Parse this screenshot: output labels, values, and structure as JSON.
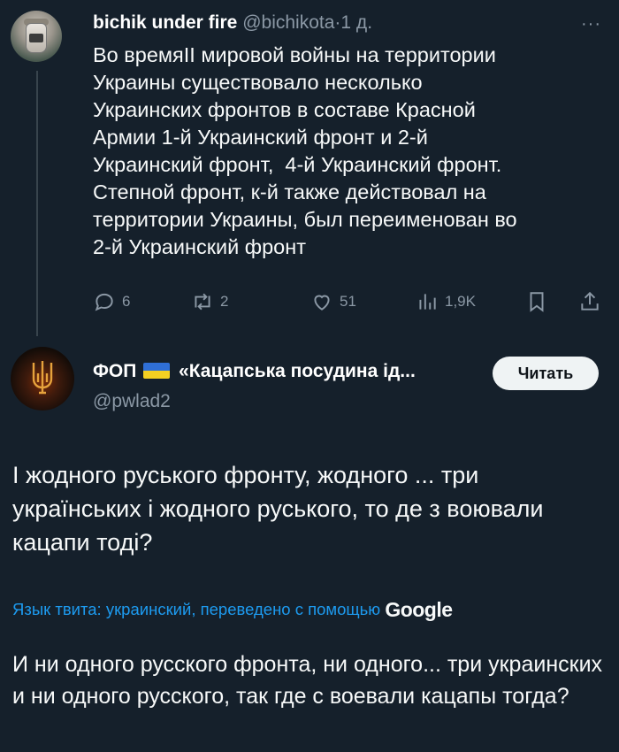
{
  "tweet1": {
    "author_name": "bichik under fire",
    "handle": "@bichikota",
    "separator": "·",
    "time": "1 д.",
    "more": "···",
    "text": "Во времяII мировой войны на территории\nУкраины существовало несколько\nУкраинских фронтов в составе Красной\nАрмии 1-й Украинский фронт и 2-й\nУкраинский фронт,  4-й Украинский фронт.\nСтепной фронт, к-й также действовал на\nтерритории Украины, был переименован во\n2-й Украинский фронт",
    "actions": {
      "replies": "6",
      "reposts": "2",
      "likes": "51",
      "views": "1,9K"
    },
    "icons": [
      "reply-icon",
      "repost-icon",
      "like-icon",
      "views-icon",
      "bookmark-icon",
      "share-icon"
    ]
  },
  "tweet2": {
    "author_name_prefix": "ФОП",
    "author_name_suffix": "«Кацапська посудина ід...",
    "handle": "@pwlad2",
    "follow_label": "Читать",
    "text": "І жодного руського фронту, жодного ... три українських і жодного руського, то де з воювали кацапи тоді?",
    "translation_note": "Язык твита: украинский, переведено с помощью",
    "translation_provider": "Google",
    "translated_text": "И ни одного русского фронта, ни одного... три украинских и ни одного русского, так где с воевали кацапы тогда?"
  },
  "colors": {
    "background": "#15202b",
    "secondary_text": "#8b98a5",
    "link": "#1d9bf0",
    "button_bg": "#eff3f4"
  }
}
